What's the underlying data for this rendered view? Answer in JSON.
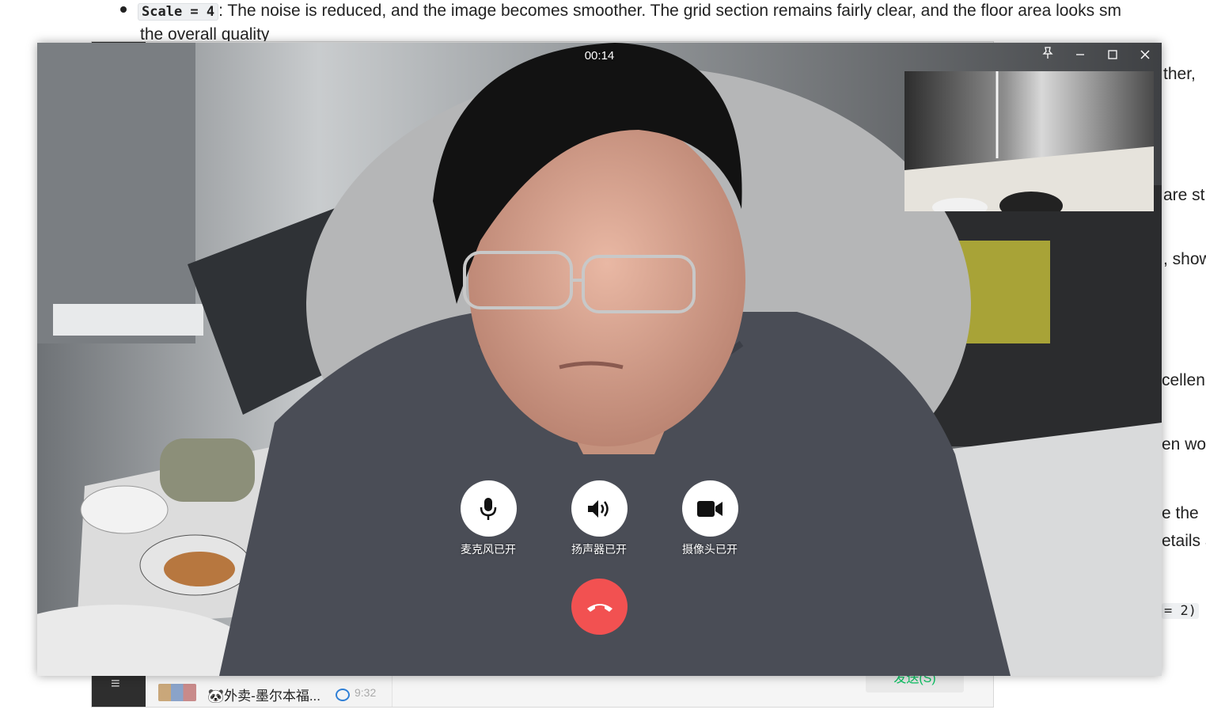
{
  "document": {
    "bullet_code": "Scale = 4",
    "bullet_text": ": The noise is reduced, and the image becomes smoother. The grid section remains fairly clear, and the floor area looks sm",
    "bullet_line2": "the overall quality",
    "fragments": [
      "ther,",
      "are st",
      ", show",
      "cellen",
      "en wo",
      "e the",
      "etails a",
      "= 2)"
    ]
  },
  "wechat": {
    "menu_icon": "hamburger-icon",
    "chat_name": "🐼外卖-墨尔本福...",
    "chat_time": "9:32",
    "send_label": "发送(S)"
  },
  "call": {
    "timer": "00:14",
    "window_controls": [
      "pin-icon",
      "minimize-icon",
      "maximize-icon",
      "close-icon"
    ],
    "controls": [
      {
        "label": "麦克风已开",
        "icon": "microphone-icon"
      },
      {
        "label": "扬声器已开",
        "icon": "speaker-icon"
      },
      {
        "label": "摄像头已开",
        "icon": "camera-icon"
      }
    ],
    "hangup_icon": "hang-up-icon",
    "colors": {
      "hangup": "#f25151",
      "control_bg": "#ffffff"
    }
  }
}
